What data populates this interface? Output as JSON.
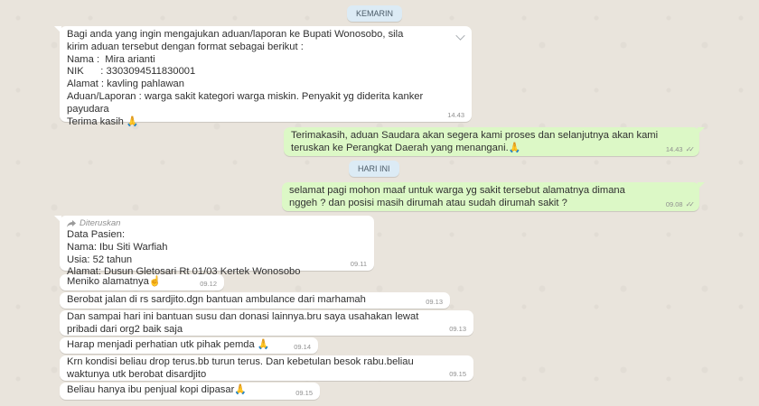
{
  "chips": {
    "yesterday": "KEMARIN",
    "today": "HARI INI"
  },
  "messages": {
    "m1": {
      "lines": [
        "Bagi anda yang ingin mengajukan aduan/laporan ke Bupati Wonosobo, sila",
        "kirim aduan tersebut dengan format sebagai berikut :",
        "Nama :  Mira arianti",
        "NIK      : 3303094511830001",
        "Alamat : kavling pahlawan",
        "Aduan/Laporan : warga sakit kategori warga miskin. Penyakit yg diderita kanker",
        "payudara",
        "",
        "Terima kasih"
      ],
      "time": "14.43",
      "emoji": "🙏"
    },
    "m2": {
      "lines": [
        "Terimakasih, aduan Saudara akan segera kami proses dan selanjutnya akan kami",
        "teruskan ke Perangkat Daerah yang menangani."
      ],
      "time": "14.43",
      "emoji": "🙏",
      "ticks": "✓✓"
    },
    "m3": {
      "lines": [
        "selamat pagi mohon maaf untuk warga yg sakit tersebut alamatnya dimana",
        "nggeh ? dan posisi masih dirumah atau sudah dirumah sakit ?"
      ],
      "time": "09.08",
      "ticks": "✓✓"
    },
    "m4": {
      "forwarded": "Diteruskan",
      "lines": [
        "Data Pasien:",
        "Nama: Ibu Siti Warfiah",
        "Usia: 52 tahun",
        "Alamat: Dusun Gletosari Rt 01/03 Kertek Wonosobo"
      ],
      "time": "09.11"
    },
    "m5": {
      "text": "Meniko alamatnya",
      "time": "09.12",
      "emoji": "☝"
    },
    "m6": {
      "text": "Berobat jalan di rs sardjito.dgn bantuan ambulance dari marhamah",
      "time": "09.13"
    },
    "m7": {
      "lines": [
        "Dan sampai hari ini bantuan susu dan donasi lainnya.bru saya usahakan lewat",
        "pribadi dari org2 baik saja"
      ],
      "time": "09.13"
    },
    "m8": {
      "text": "Harap menjadi perhatian utk pihak pemda",
      "time": "09.14",
      "emoji": "🙏"
    },
    "m9": {
      "lines": [
        "Krn kondisi beliau drop terus.bb turun terus. Dan kebetulan besok rabu.beliau",
        "waktunya utk berobat disardjito"
      ],
      "time": "09.15"
    },
    "m10": {
      "text": "Beliau hanya ibu penjual kopi dipasar",
      "time": "09.15",
      "emoji": "🙏"
    }
  }
}
